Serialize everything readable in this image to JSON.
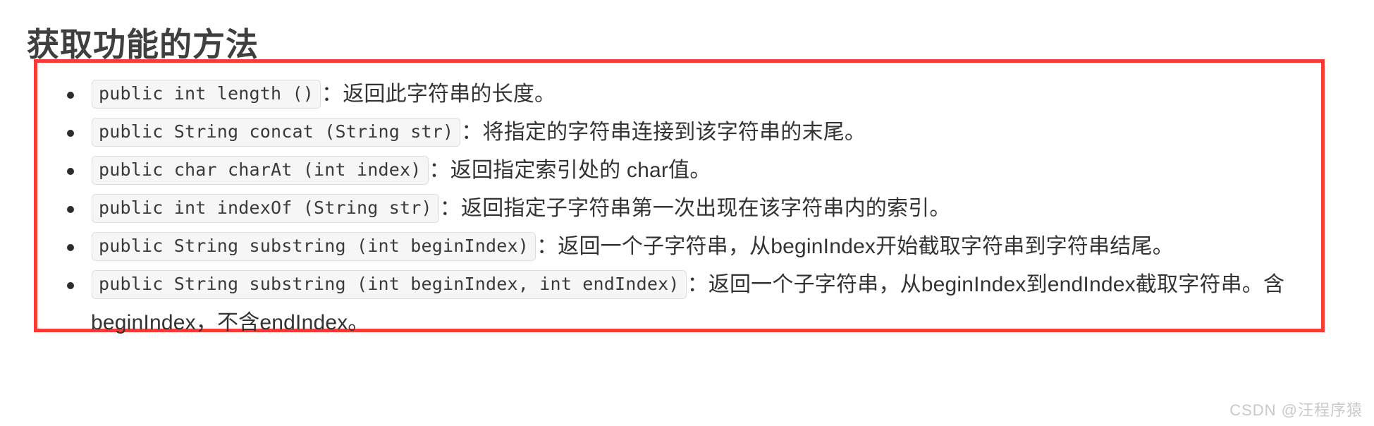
{
  "page": {
    "title": "获取功能的方法",
    "accent_color": "#fc3a35",
    "text_color": "#333333",
    "code_background": "#f6f6f6",
    "code_border": "#dddddd"
  },
  "methods": [
    {
      "signature": "public int length ()",
      "description": "：返回此字符串的长度。"
    },
    {
      "signature": "public String concat (String str)",
      "description": "：将指定的字符串连接到该字符串的末尾。"
    },
    {
      "signature": "public char charAt (int index)",
      "description": "：返回指定索引处的 char值。"
    },
    {
      "signature": "public int indexOf (String str)",
      "description": "：返回指定子字符串第一次出现在该字符串内的索引。"
    },
    {
      "signature": "public String substring (int beginIndex)",
      "description": "：返回一个子字符串，从beginIndex开始截取字符串到字符串结尾。"
    },
    {
      "signature": "public String substring (int beginIndex, int endIndex)",
      "description": "：返回一个子字符串，从beginIndex到endIndex截取字符串。含beginIndex，不含endIndex。"
    }
  ],
  "watermark": {
    "text": "CSDN @汪程序猿"
  }
}
